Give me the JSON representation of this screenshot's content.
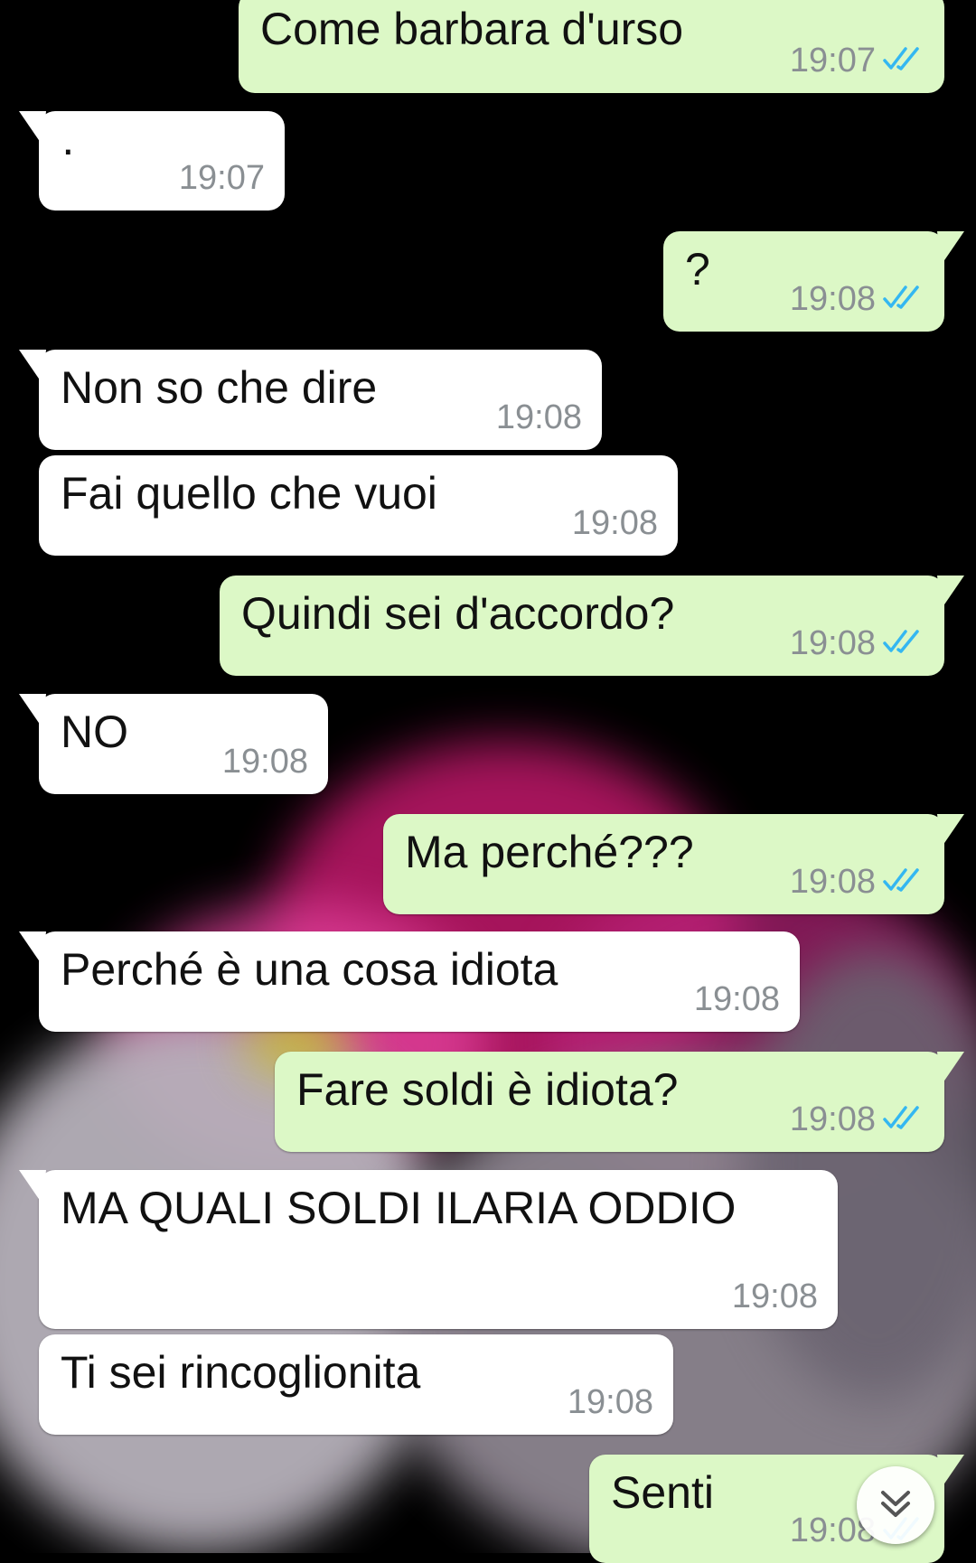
{
  "messages": [
    {
      "side": "out",
      "text": "Come barbara d'urso",
      "time": "19:07",
      "ticks": true
    },
    {
      "side": "in",
      "text": "·",
      "time": "19:07",
      "ticks": false
    },
    {
      "side": "out",
      "text": "?",
      "time": "19:08",
      "ticks": true
    },
    {
      "side": "in",
      "text": "Non so che dire",
      "time": "19:08",
      "ticks": false
    },
    {
      "side": "in",
      "text": "Fai quello che vuoi",
      "time": "19:08",
      "ticks": false
    },
    {
      "side": "out",
      "text": "Quindi sei d'accordo?",
      "time": "19:08",
      "ticks": true
    },
    {
      "side": "in",
      "text": "NO",
      "time": "19:08",
      "ticks": false
    },
    {
      "side": "out",
      "text": "Ma perché???",
      "time": "19:08",
      "ticks": true
    },
    {
      "side": "in",
      "text": "Perché è una cosa idiota",
      "time": "19:08",
      "ticks": false
    },
    {
      "side": "out",
      "text": "Fare soldi è idiota?",
      "time": "19:08",
      "ticks": true
    },
    {
      "side": "in",
      "text": "MA QUALI SOLDI ILARIA ODDIO",
      "time": "19:08",
      "ticks": false
    },
    {
      "side": "in",
      "text": "Ti sei rincoglionita",
      "time": "19:08",
      "ticks": false
    },
    {
      "side": "out",
      "text": "Senti",
      "time": "19:08",
      "ticks": true
    }
  ],
  "colors": {
    "outgoing_bubble": "#dcf8c6",
    "incoming_bubble": "#ffffff",
    "read_ticks": "#34b7f1",
    "timestamp": "#8a8f93"
  },
  "icons": {
    "read_receipt": "double-check-icon",
    "scroll_down": "double-chevron-down-icon"
  }
}
